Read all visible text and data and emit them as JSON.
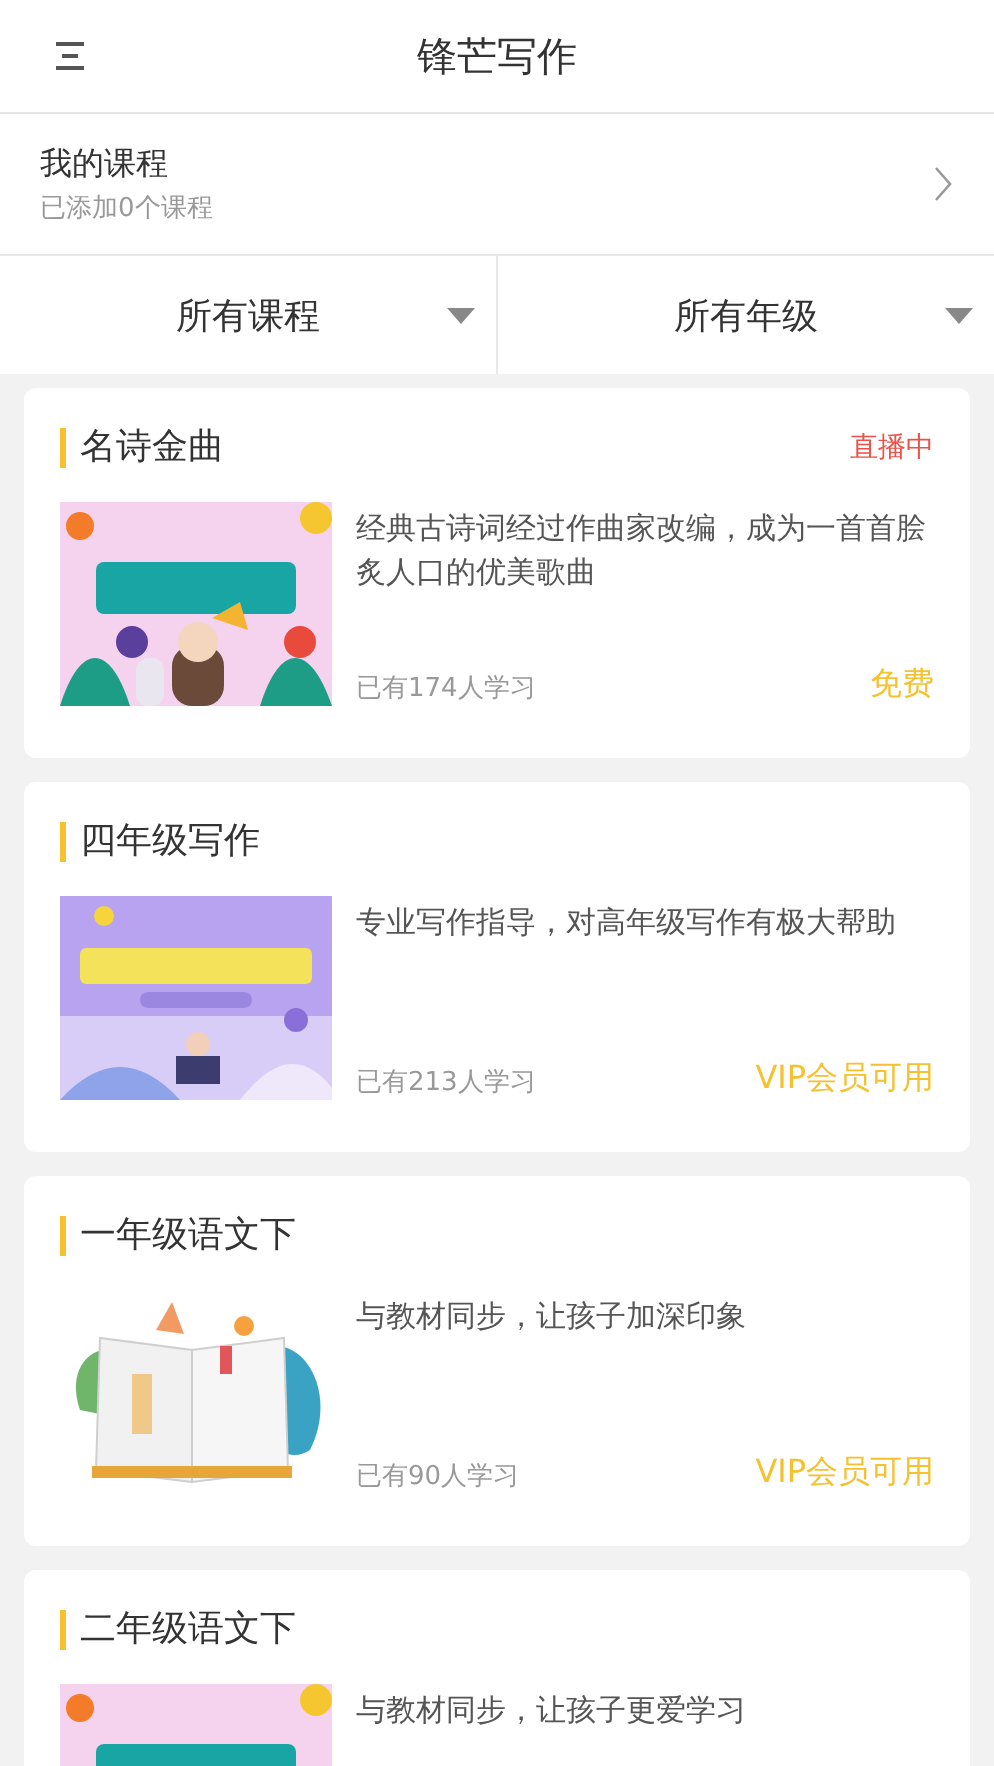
{
  "header": {
    "title": "锋芒写作"
  },
  "my_courses": {
    "title": "我的课程",
    "subtitle": "已添加0个课程"
  },
  "filters": [
    {
      "label": "所有课程"
    },
    {
      "label": "所有年级"
    }
  ],
  "courses": [
    {
      "title": "名诗金曲",
      "status": "直播中",
      "description": "经典古诗词经过作曲家改编，成为一首首脍炙人口的优美歌曲",
      "learners": "已有174人学习",
      "price": "免费"
    },
    {
      "title": "四年级写作",
      "description": "专业写作指导，对高年级写作有极大帮助",
      "learners": "已有213人学习",
      "price": "VIP会员可用"
    },
    {
      "title": "一年级语文下",
      "description": "与教材同步，让孩子加深印象",
      "learners": "已有90人学习",
      "price": "VIP会员可用"
    },
    {
      "title": "二年级语文下",
      "description": "与教材同步，让孩子更爱学习"
    }
  ]
}
